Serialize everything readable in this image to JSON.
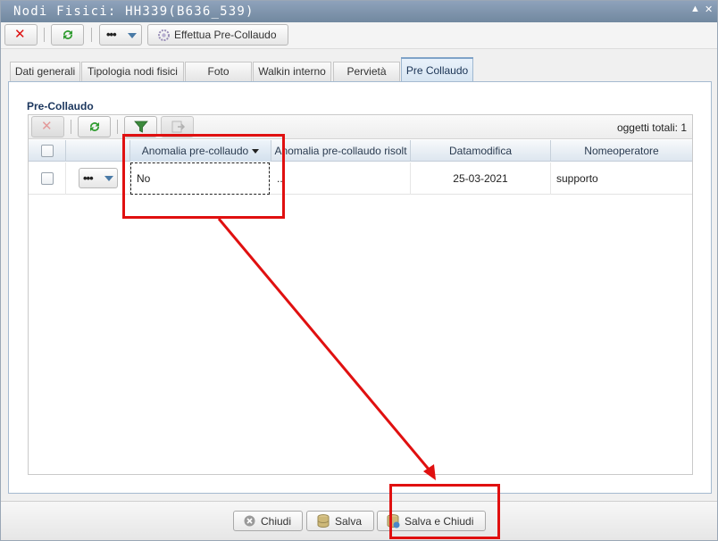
{
  "window": {
    "title": "Nodi Fisici: HH339(B636_539)",
    "controls": [
      "▲",
      "✕"
    ]
  },
  "toolbar": {
    "close_icon": "red-x-icon",
    "refresh_icon": "green-refresh-icon",
    "more_label": "•••",
    "precollaudo_label": "Effettua Pre-Collaudo"
  },
  "tabs": [
    {
      "label": "Dati generali",
      "active": false
    },
    {
      "label": "Tipologia nodi fisici",
      "active": false
    },
    {
      "label": "Foto",
      "active": false
    },
    {
      "label": "Walkin interno",
      "active": false
    },
    {
      "label": "Pervietà",
      "active": false
    },
    {
      "label": "Pre Collaudo",
      "active": true
    }
  ],
  "section": {
    "title": "Pre-Collaudo"
  },
  "grid": {
    "total_label": "oggetti totali: 1",
    "columns": [
      {
        "label": ""
      },
      {
        "label": ""
      },
      {
        "label": "Anomalia pre-collaudo",
        "sorted": true
      },
      {
        "label": "Anomalia pre-collaudo risolt"
      },
      {
        "label": "Datamodifica"
      },
      {
        "label": "Nomeoperatore"
      }
    ],
    "rows": [
      {
        "actions": "•••",
        "anomalia": "No",
        "risolta": "...",
        "datamodifica": "25-03-2021",
        "operatore": "supporto"
      }
    ]
  },
  "footer": {
    "chiudi": "Chiudi",
    "salva": "Salva",
    "salva_chiudi": "Salva e Chiudi"
  },
  "colors": {
    "accent": "#7fa3c8",
    "annotation": "#e01010",
    "titlebar": "#71889f"
  }
}
